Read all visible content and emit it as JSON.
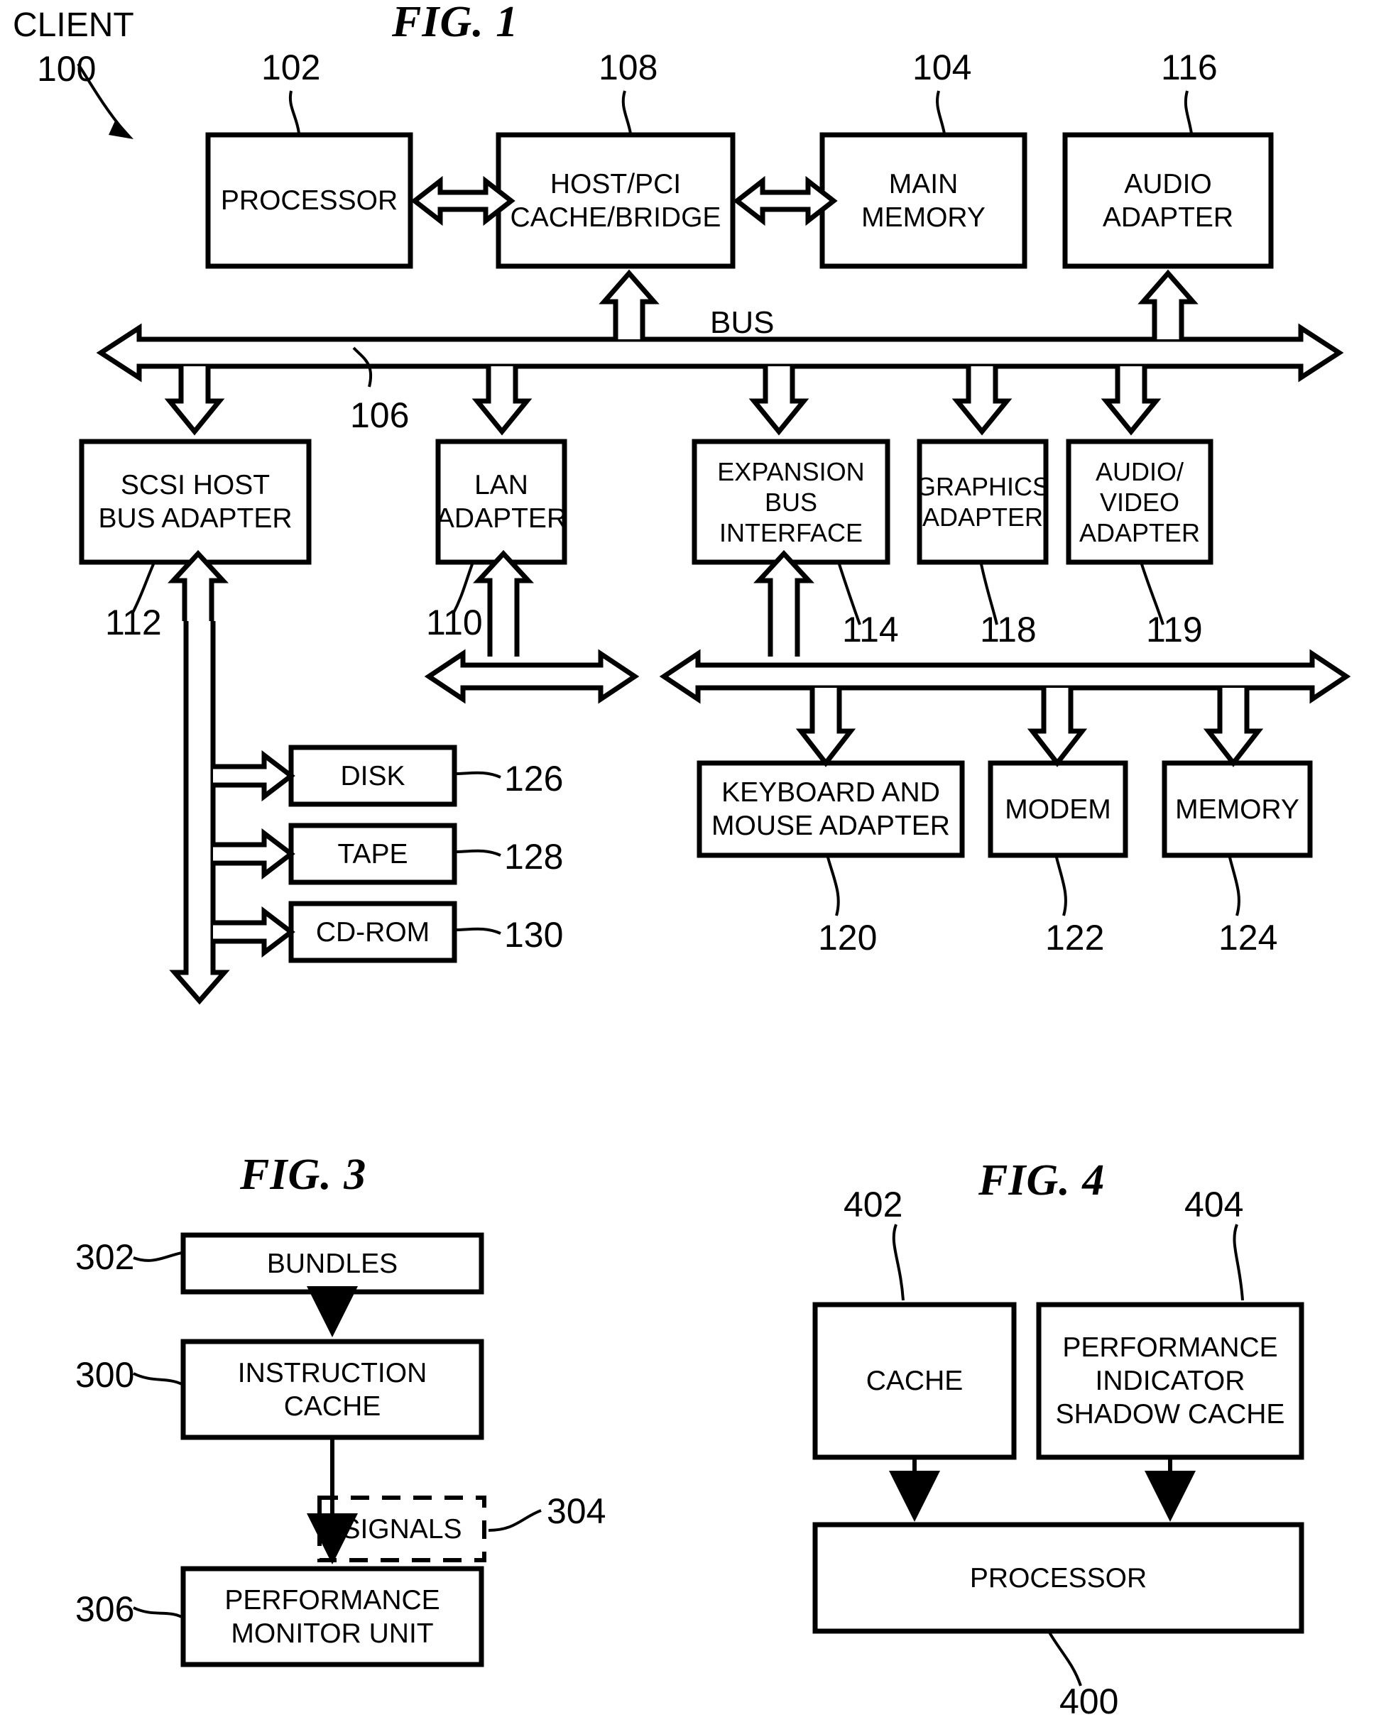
{
  "sheet": {
    "figures": [
      {
        "id": "fig1",
        "title": "FIG. 1",
        "system_label": "CLIENT",
        "system_ref": "100",
        "bus_label": "BUS",
        "blocks": [
          {
            "key": "processor",
            "label": "PROCESSOR",
            "ref": "102"
          },
          {
            "key": "host_pci_bridge",
            "label": "HOST/PCI\nCACHE/BRIDGE",
            "ref": "108"
          },
          {
            "key": "main_memory",
            "label": "MAIN\nMEMORY",
            "ref": "104"
          },
          {
            "key": "audio_adapter",
            "label": "AUDIO\nADAPTER",
            "ref": "116"
          },
          {
            "key": "bus",
            "label": "BUS",
            "ref": "106"
          },
          {
            "key": "scsi_host",
            "label": "SCSI HOST\nBUS ADAPTER",
            "ref": "112"
          },
          {
            "key": "lan_adapter",
            "label": "LAN\nADAPTER",
            "ref": "110"
          },
          {
            "key": "expansion_bus",
            "label": "EXPANSION\nBUS\nINTERFACE",
            "ref": "114"
          },
          {
            "key": "graphics_adapter",
            "label": "GRAPHICS\nADAPTER",
            "ref": "118"
          },
          {
            "key": "av_adapter",
            "label": "AUDIO/\nVIDEO\nADAPTER",
            "ref": "119"
          },
          {
            "key": "disk",
            "label": "DISK",
            "ref": "126"
          },
          {
            "key": "tape",
            "label": "TAPE",
            "ref": "128"
          },
          {
            "key": "cdrom",
            "label": "CD-ROM",
            "ref": "130"
          },
          {
            "key": "kbd_mouse",
            "label": "KEYBOARD AND\nMOUSE ADAPTER",
            "ref": "120"
          },
          {
            "key": "modem",
            "label": "MODEM",
            "ref": "122"
          },
          {
            "key": "memory",
            "label": "MEMORY",
            "ref": "124"
          }
        ]
      },
      {
        "id": "fig3",
        "title": "FIG. 3",
        "blocks": [
          {
            "key": "bundles",
            "label": "BUNDLES",
            "ref": "302"
          },
          {
            "key": "instruction_cache",
            "label": "INSTRUCTION\nCACHE",
            "ref": "300"
          },
          {
            "key": "signals",
            "label": "SIGNALS",
            "ref": "304"
          },
          {
            "key": "perf_monitor_unit",
            "label": "PERFORMANCE\nMONITOR UNIT",
            "ref": "306"
          }
        ]
      },
      {
        "id": "fig4",
        "title": "FIG. 4",
        "blocks": [
          {
            "key": "cache",
            "label": "CACHE",
            "ref": "402"
          },
          {
            "key": "shadow_cache",
            "label": "PERFORMANCE\nINDICATOR\nSHADOW CACHE",
            "ref": "404"
          },
          {
            "key": "processor",
            "label": "PROCESSOR",
            "ref": "400"
          }
        ]
      }
    ],
    "colors": {
      "ink": "#000000",
      "paper": "#ffffff"
    }
  }
}
